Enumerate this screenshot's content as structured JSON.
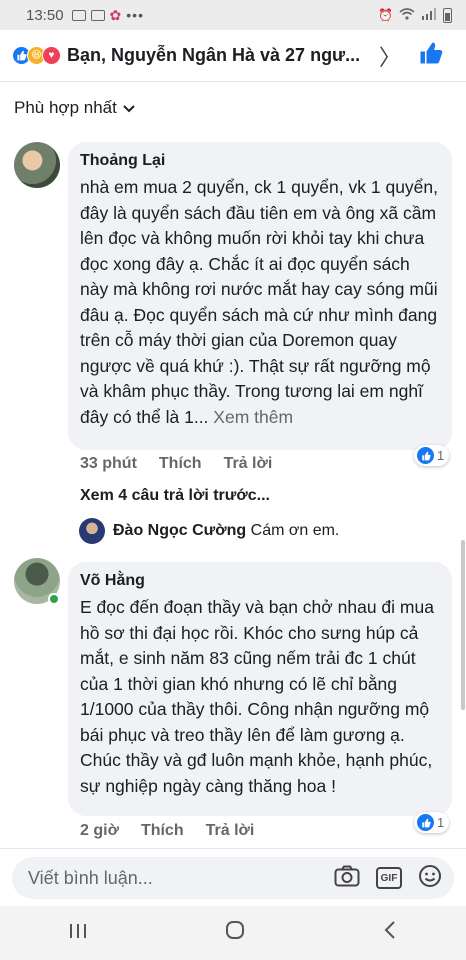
{
  "status": {
    "time": "13:50",
    "more": "•••"
  },
  "header": {
    "reactors": "Bạn, Nguyễn Ngân Hà và 27 ngư...",
    "reaction_icons": [
      "like-icon",
      "haha-icon",
      "love-icon"
    ]
  },
  "sort": {
    "label": "Phù hợp nhất"
  },
  "comments": [
    {
      "author": "Thoảng Lại",
      "text": "nhà em mua 2 quyển, ck 1 quyển, vk 1 quyển, đây là quyển sách đầu tiên em và ông xã cầm lên đọc và không muốn rời khỏi tay khi chưa đọc xong đây ạ. Chắc ít ai đọc quyển sách này mà không rơi nước mắt hay cay sóng mũi đâu ạ. Đọc quyển sách mà cứ như mình đang trên cỗ máy thời gian của Doremon quay ngược về quá khứ :). Thật sự rất ngưỡng mộ và khâm phục thầy. Trong tương lai em nghĩ đây có thể là 1...",
      "see_more": "Xem thêm",
      "time": "33 phút",
      "like": "Thích",
      "reply": "Trả lời",
      "reaction_count": "1"
    },
    {
      "author": "Võ Hằng",
      "text": "E đọc đến đoạn thầy và bạn chở nhau đi mua hồ sơ thi đại học rồi. Khóc cho sưng húp cả mắt, e sinh năm 83 cũng nếm trải đc 1 chút của 1 thời gian khó nhưng có lẽ chỉ bằng 1/1000 của thầy thôi. Công nhận ngưỡng mộ bái phục và treo thầy lên để làm gương ạ.",
      "text2": "Chúc thầy và gđ luôn mạnh khỏe, hạnh phúc, sự nghiệp ngày càng thăng hoa !",
      "time": "2 giờ",
      "like": "Thích",
      "reply": "Trả lời",
      "reaction_count": "1"
    }
  ],
  "replies": {
    "view_previous": "Xem 4 câu trả lời trước...",
    "author": "Đào Ngọc Cường",
    "text": "Cám ơn em."
  },
  "composer": {
    "placeholder": "Viết bình luận..."
  },
  "colors": {
    "accent": "#1877f2",
    "bubble": "#f0f2f5",
    "muted": "#65676b",
    "online": "#31a24c"
  }
}
